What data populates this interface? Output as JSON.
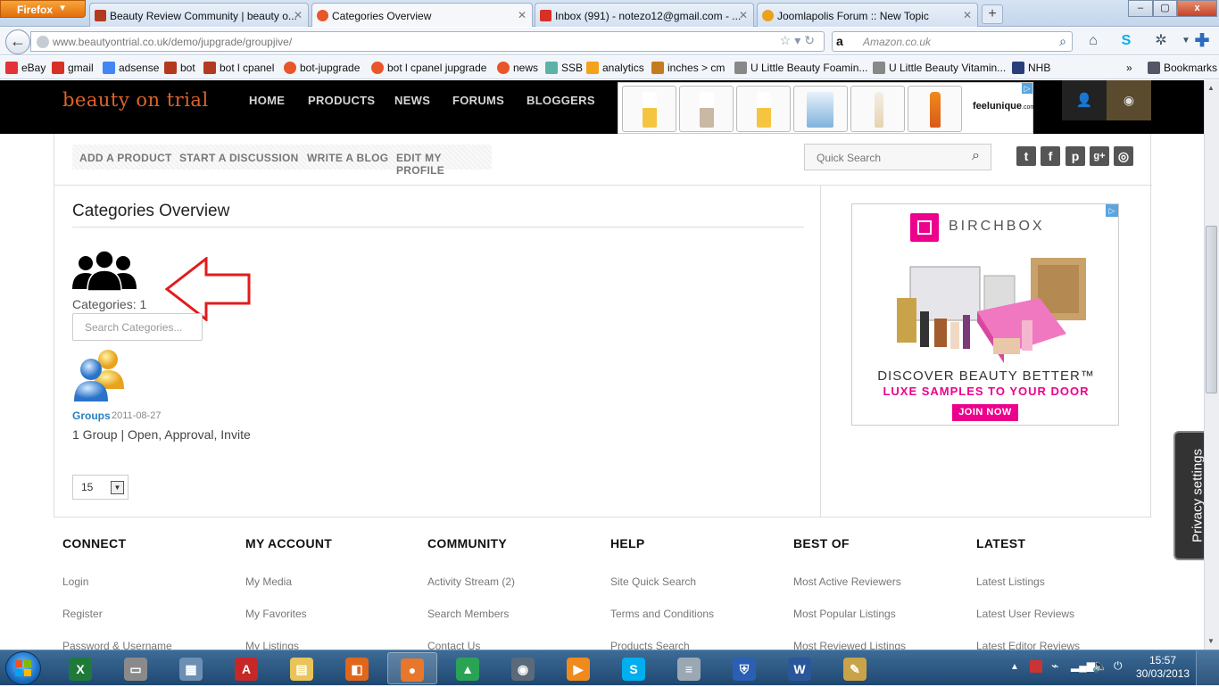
{
  "browser": {
    "menu_label": "Firefox",
    "tabs": [
      {
        "title": "Beauty Review Community | beauty o...",
        "icon": "jomsocial-icon",
        "color": "#b33a1f"
      },
      {
        "title": "Categories Overview",
        "icon": "joomla-icon",
        "color": "#e8562a"
      },
      {
        "title": "Inbox (991) - notezo12@gmail.com - ...",
        "icon": "gmail-icon",
        "color": "#d93025"
      },
      {
        "title": "Joomlapolis Forum :: New Topic",
        "icon": "joomlapolis-icon",
        "color": "#e8a21c"
      }
    ],
    "window_controls": {
      "minimize": "–",
      "maximize": "▢",
      "close": "x"
    },
    "url": "www.beautyontrial.co.uk/demo/jupgrade/groupjive/",
    "search_placeholder": "Amazon.co.uk",
    "bookmarks": [
      {
        "label": "eBay",
        "color": "#e53238"
      },
      {
        "label": "gmail",
        "color": "#d93025"
      },
      {
        "label": "adsense",
        "color": "#4285f4"
      },
      {
        "label": "bot",
        "color": "#b33a1f"
      },
      {
        "label": "bot l cpanel",
        "color": "#b33a1f"
      },
      {
        "label": "bot-jupgrade",
        "color": "#e8562a"
      },
      {
        "label": "bot l cpanel  jupgrade",
        "color": "#e8562a"
      },
      {
        "label": "news",
        "color": "#e8562a"
      },
      {
        "label": "SSB",
        "color": "#5bb3a8"
      },
      {
        "label": "analytics",
        "color": "#f4a11b"
      },
      {
        "label": "inches > cm",
        "color": "#c47d1e"
      },
      {
        "label": "U Little Beauty Foamin...",
        "color": "#888888"
      },
      {
        "label": "U Little Beauty Vitamin...",
        "color": "#888888"
      },
      {
        "label": "NHB",
        "color": "#2a3f7a"
      }
    ],
    "bookmarks_more": "»",
    "bookmarks_menu": "Bookmarks"
  },
  "site": {
    "logo": "beauty on trial",
    "nav": [
      "HOME",
      "PRODUCTS",
      "NEWS",
      "FORUMS",
      "BLOGGERS"
    ],
    "ad_brand": "feelunique",
    "ad_brand_suffix": ".com",
    "subnav": [
      "ADD A PRODUCT",
      "START A DISCUSSION",
      "WRITE A BLOG",
      "EDIT MY PROFILE"
    ],
    "quick_search_placeholder": "Quick Search",
    "social": [
      {
        "name": "twitter-icon",
        "glyph": "t"
      },
      {
        "name": "facebook-icon",
        "glyph": "f"
      },
      {
        "name": "pinterest-icon",
        "glyph": "p"
      },
      {
        "name": "googleplus-icon",
        "glyph": "g+"
      },
      {
        "name": "instagram-icon",
        "glyph": "◎"
      }
    ]
  },
  "main": {
    "title": "Categories Overview",
    "categories_count": "Categories: 1",
    "search_placeholder": "Search Categories...",
    "group": {
      "name": "Groups",
      "date": "2011-08-27",
      "description": "1 Group | Open, Approval, Invite"
    },
    "per_page": "15"
  },
  "birchbox_ad": {
    "brand": "BIRCHBOX",
    "headline": "DISCOVER BEAUTY BETTER™",
    "subheadline": "LUXE SAMPLES TO YOUR DOOR",
    "cta": "JOIN NOW"
  },
  "privacy_tab": "Privacy settings",
  "footer": {
    "columns": [
      {
        "heading": "CONNECT",
        "links": [
          "Login",
          "Register",
          "Password & Username"
        ]
      },
      {
        "heading": "MY ACCOUNT",
        "links": [
          "My Media",
          "My Favorites",
          "My Listings"
        ]
      },
      {
        "heading": "COMMUNITY",
        "links": [
          "Activity Stream (2)",
          "Search Members",
          "Contact Us"
        ]
      },
      {
        "heading": "HELP",
        "links": [
          "Site Quick Search",
          "Terms and Conditions",
          "Products Search"
        ]
      },
      {
        "heading": "BEST OF",
        "links": [
          "Most Active Reviewers",
          "Most Popular Listings",
          "Most Reviewed Listings"
        ]
      },
      {
        "heading": "LATEST",
        "links": [
          "Latest Listings",
          "Latest User Reviews",
          "Latest Editor Reviews"
        ]
      }
    ]
  },
  "taskbar": {
    "clock_time": "15:57",
    "clock_date": "30/03/2013",
    "apps": [
      {
        "name": "excel-icon",
        "color": "#1f7a3a",
        "glyph": "X"
      },
      {
        "name": "scanner-icon",
        "color": "#8a8a8a",
        "glyph": "▭"
      },
      {
        "name": "calculator-icon",
        "color": "#6c8fb3",
        "glyph": "▦"
      },
      {
        "name": "acrobat-icon",
        "color": "#c62828",
        "glyph": "A"
      },
      {
        "name": "explorer-folder-icon",
        "color": "#e8c45a",
        "glyph": "▤"
      },
      {
        "name": "office-icon",
        "color": "#e0661b",
        "glyph": "◧"
      },
      {
        "name": "firefox-icon",
        "color": "#e8772b",
        "glyph": "●"
      },
      {
        "name": "google-drive-icon",
        "color": "#2aa354",
        "glyph": "▲"
      },
      {
        "name": "camera-icon",
        "color": "#5a6a7a",
        "glyph": "◉"
      },
      {
        "name": "media-player-icon",
        "color": "#f08a1c",
        "glyph": "▶"
      },
      {
        "name": "skype-icon",
        "color": "#00aff0",
        "glyph": "S"
      },
      {
        "name": "notepad-icon",
        "color": "#9aa8b4",
        "glyph": "≡"
      },
      {
        "name": "security-shield-icon",
        "color": "#2a5fb3",
        "glyph": "⛨"
      },
      {
        "name": "word-icon",
        "color": "#2b579a",
        "glyph": "W"
      },
      {
        "name": "paint-icon",
        "color": "#c9a34a",
        "glyph": "✎"
      }
    ]
  }
}
